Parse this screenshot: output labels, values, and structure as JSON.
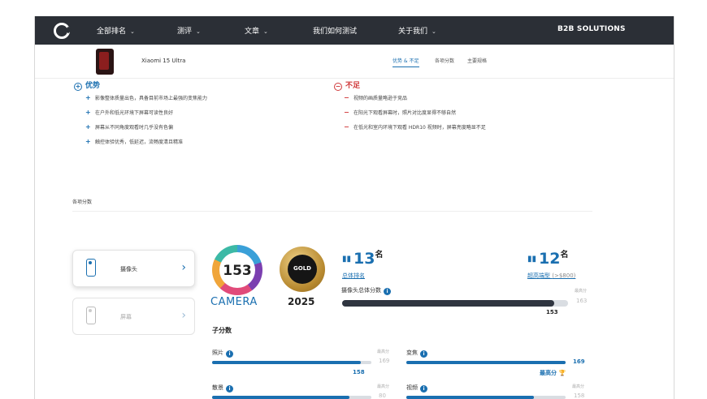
{
  "nav": {
    "items": [
      {
        "label": "全部排名",
        "chevron": true
      },
      {
        "label": "测评",
        "chevron": true
      },
      {
        "label": "文章",
        "chevron": true
      },
      {
        "label": "我们如何测试",
        "chevron": false
      },
      {
        "label": "关于我们",
        "chevron": true
      }
    ],
    "b2b": "B2B SOLUTIONS"
  },
  "product": {
    "name": "Xiaomi 15 Ultra",
    "tabs": [
      "优势 & 不足",
      "各项分数",
      "主要规格"
    ],
    "active_tab": 0
  },
  "pros": {
    "heading": "优势",
    "items": [
      "影像整体质量出色，具备目前市场上最强的变焦能力",
      "在户外和低光环境下屏幕可读性良好",
      "屏幕从不同角度观看时几乎没有色偏",
      "触控体验优秀，低延迟，流畅度清且精准"
    ]
  },
  "cons": {
    "heading": "不足",
    "items": [
      "视频的画质量略逊于竞品",
      "在阳光下观看屏幕时，照片对比度显得不够自然",
      "在低光和室内环境下观看 HDR10 视频时，屏幕亮度略显不足"
    ]
  },
  "scores_section_label": "各项分数",
  "categories": [
    {
      "label": "摄像头",
      "active": true
    },
    {
      "label": "屏幕",
      "active": false
    }
  ],
  "camera_badge": {
    "score": "153",
    "label": "CAMERA"
  },
  "gold_badge": {
    "label": "GOLD",
    "year": "2025"
  },
  "rank_overall": {
    "value": "13",
    "suffix": "名",
    "label": "总体排名"
  },
  "rank_segment": {
    "value": "12",
    "suffix": "名",
    "label": "超高端型",
    "note": "(>$800)"
  },
  "overall_camera": {
    "label": "摄像头总体分数",
    "value": "153",
    "max_label": "最高分",
    "max": "163",
    "fraction": 0.94,
    "bar_color": "#2f3540"
  },
  "subscores_title": "子分数",
  "subscores": [
    {
      "label": "照片",
      "value": "158",
      "max_label": "最高分",
      "max": "169",
      "fraction": 0.935
    },
    {
      "label": "变焦",
      "value": "169",
      "max_label": "",
      "max": "",
      "fraction": 1.0,
      "best": "最高分"
    },
    {
      "label": "散景",
      "value": "",
      "max_label": "最高分",
      "max": "80",
      "fraction": 0.86
    },
    {
      "label": "视频",
      "value": "",
      "max_label": "最高分",
      "max": "158",
      "fraction": 0.8
    }
  ],
  "colors": {
    "accent": "#1a6fb0",
    "nav_bg": "#2b2f36",
    "cons": "#d0393a"
  }
}
